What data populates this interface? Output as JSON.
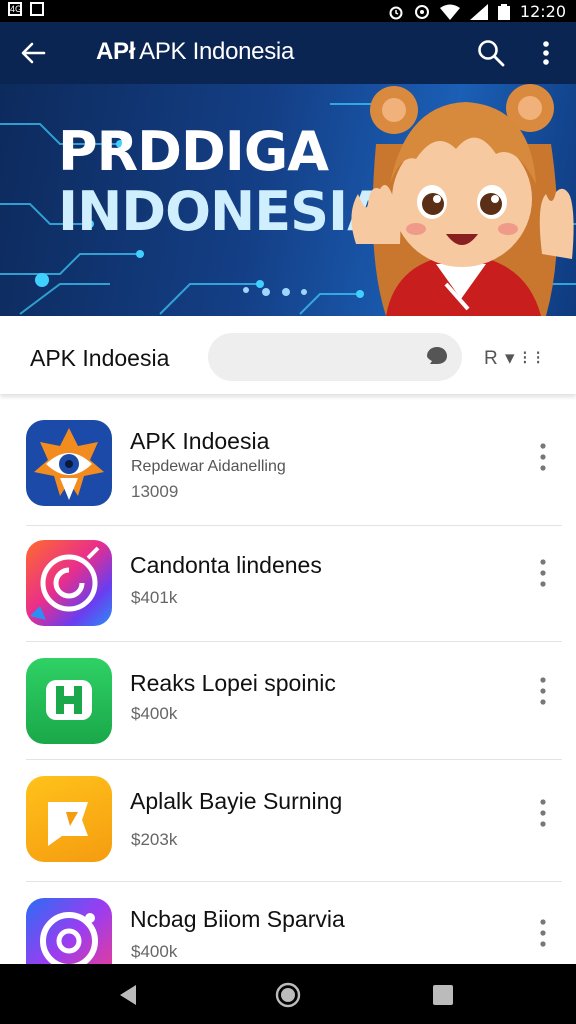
{
  "status_bar": {
    "left_icons": [
      "4G",
      "sim-card"
    ],
    "right_icons": [
      "alarm-icon",
      "do-not-disturb-icon",
      "wifi-icon",
      "signal-icon",
      "battery-icon"
    ],
    "time": "12:20"
  },
  "app_bar": {
    "title_prefix": "APł",
    "title": "APK Indonesia",
    "icons": [
      "back-arrow-icon",
      "search-icon",
      "more-vert-icon"
    ]
  },
  "banner": {
    "line1": "PRDDIGA",
    "line2": "INDONESIA",
    "colors": {
      "bg": "#143f86",
      "text": "#ffffff",
      "accent": "#cfefff"
    }
  },
  "filter_bar": {
    "label": "APK Indoesia",
    "sort_label": "R ▾ ⁝ ⁝"
  },
  "apps": [
    {
      "name": "APK Indoesia",
      "subtitle": "Repdewar Aidanelling",
      "meta": "13009",
      "icon": "eye-shield-icon"
    },
    {
      "name": "Candonta lindenes",
      "subtitle": "",
      "meta": "$401k",
      "icon": "circle-swirl-icon"
    },
    {
      "name": "Reaks Lopei spoinic",
      "subtitle": "",
      "meta": "$400k",
      "icon": "letter-h-icon"
    },
    {
      "name": "Aplalk Bayie Surning",
      "subtitle": "",
      "meta": "$203k",
      "icon": "folded-map-icon"
    },
    {
      "name": "Ncbag Biiom Sparvia",
      "subtitle": "",
      "meta": "$400k",
      "icon": "camera-ring-icon"
    }
  ],
  "nav_bar": {
    "buttons": [
      "back-triangle-icon",
      "home-circle-icon",
      "recents-square-icon"
    ]
  }
}
